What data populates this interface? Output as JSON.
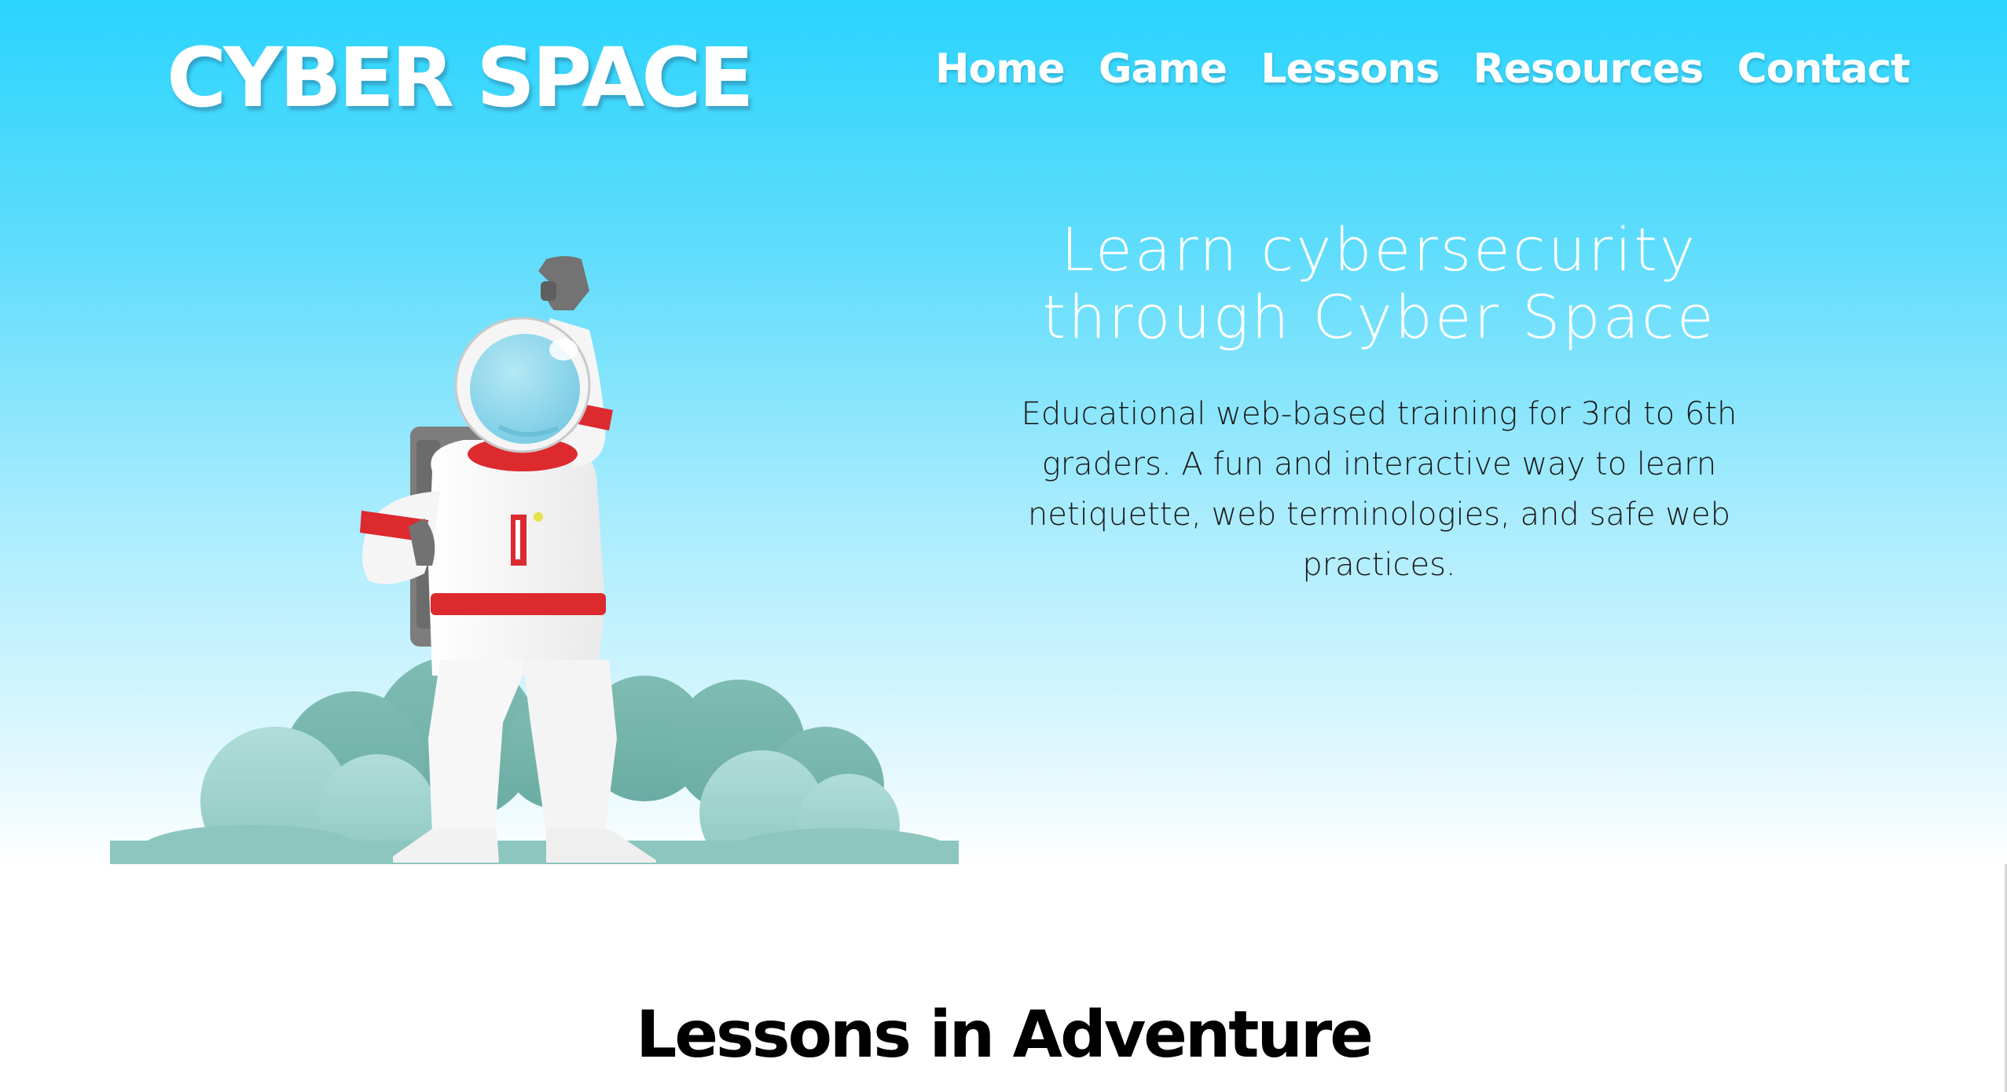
{
  "brand": {
    "logo": "CYBER SPACE"
  },
  "nav": {
    "items": [
      "Home",
      "Game",
      "Lessons",
      "Resources",
      "Contact"
    ]
  },
  "hero": {
    "title_line1": "Learn cybersecurity",
    "title_line2": "through Cyber Space",
    "description": "Educational web-based training for 3rd to 6th graders. A fun and interactive way to learn netiquette, web terminologies, and safe web practices."
  },
  "section": {
    "title": "Lessons in Adventure"
  },
  "colors": {
    "sky_top": "#2ad4fd",
    "sky_bottom": "#ffffff",
    "suit": "#f7f7f7",
    "stripe": "#dc2a2f",
    "visor": "#8ad6ec",
    "clouds": "#74b2aa",
    "glove": "#727272"
  },
  "icons": {
    "illustration": "astronaut-illustration"
  }
}
